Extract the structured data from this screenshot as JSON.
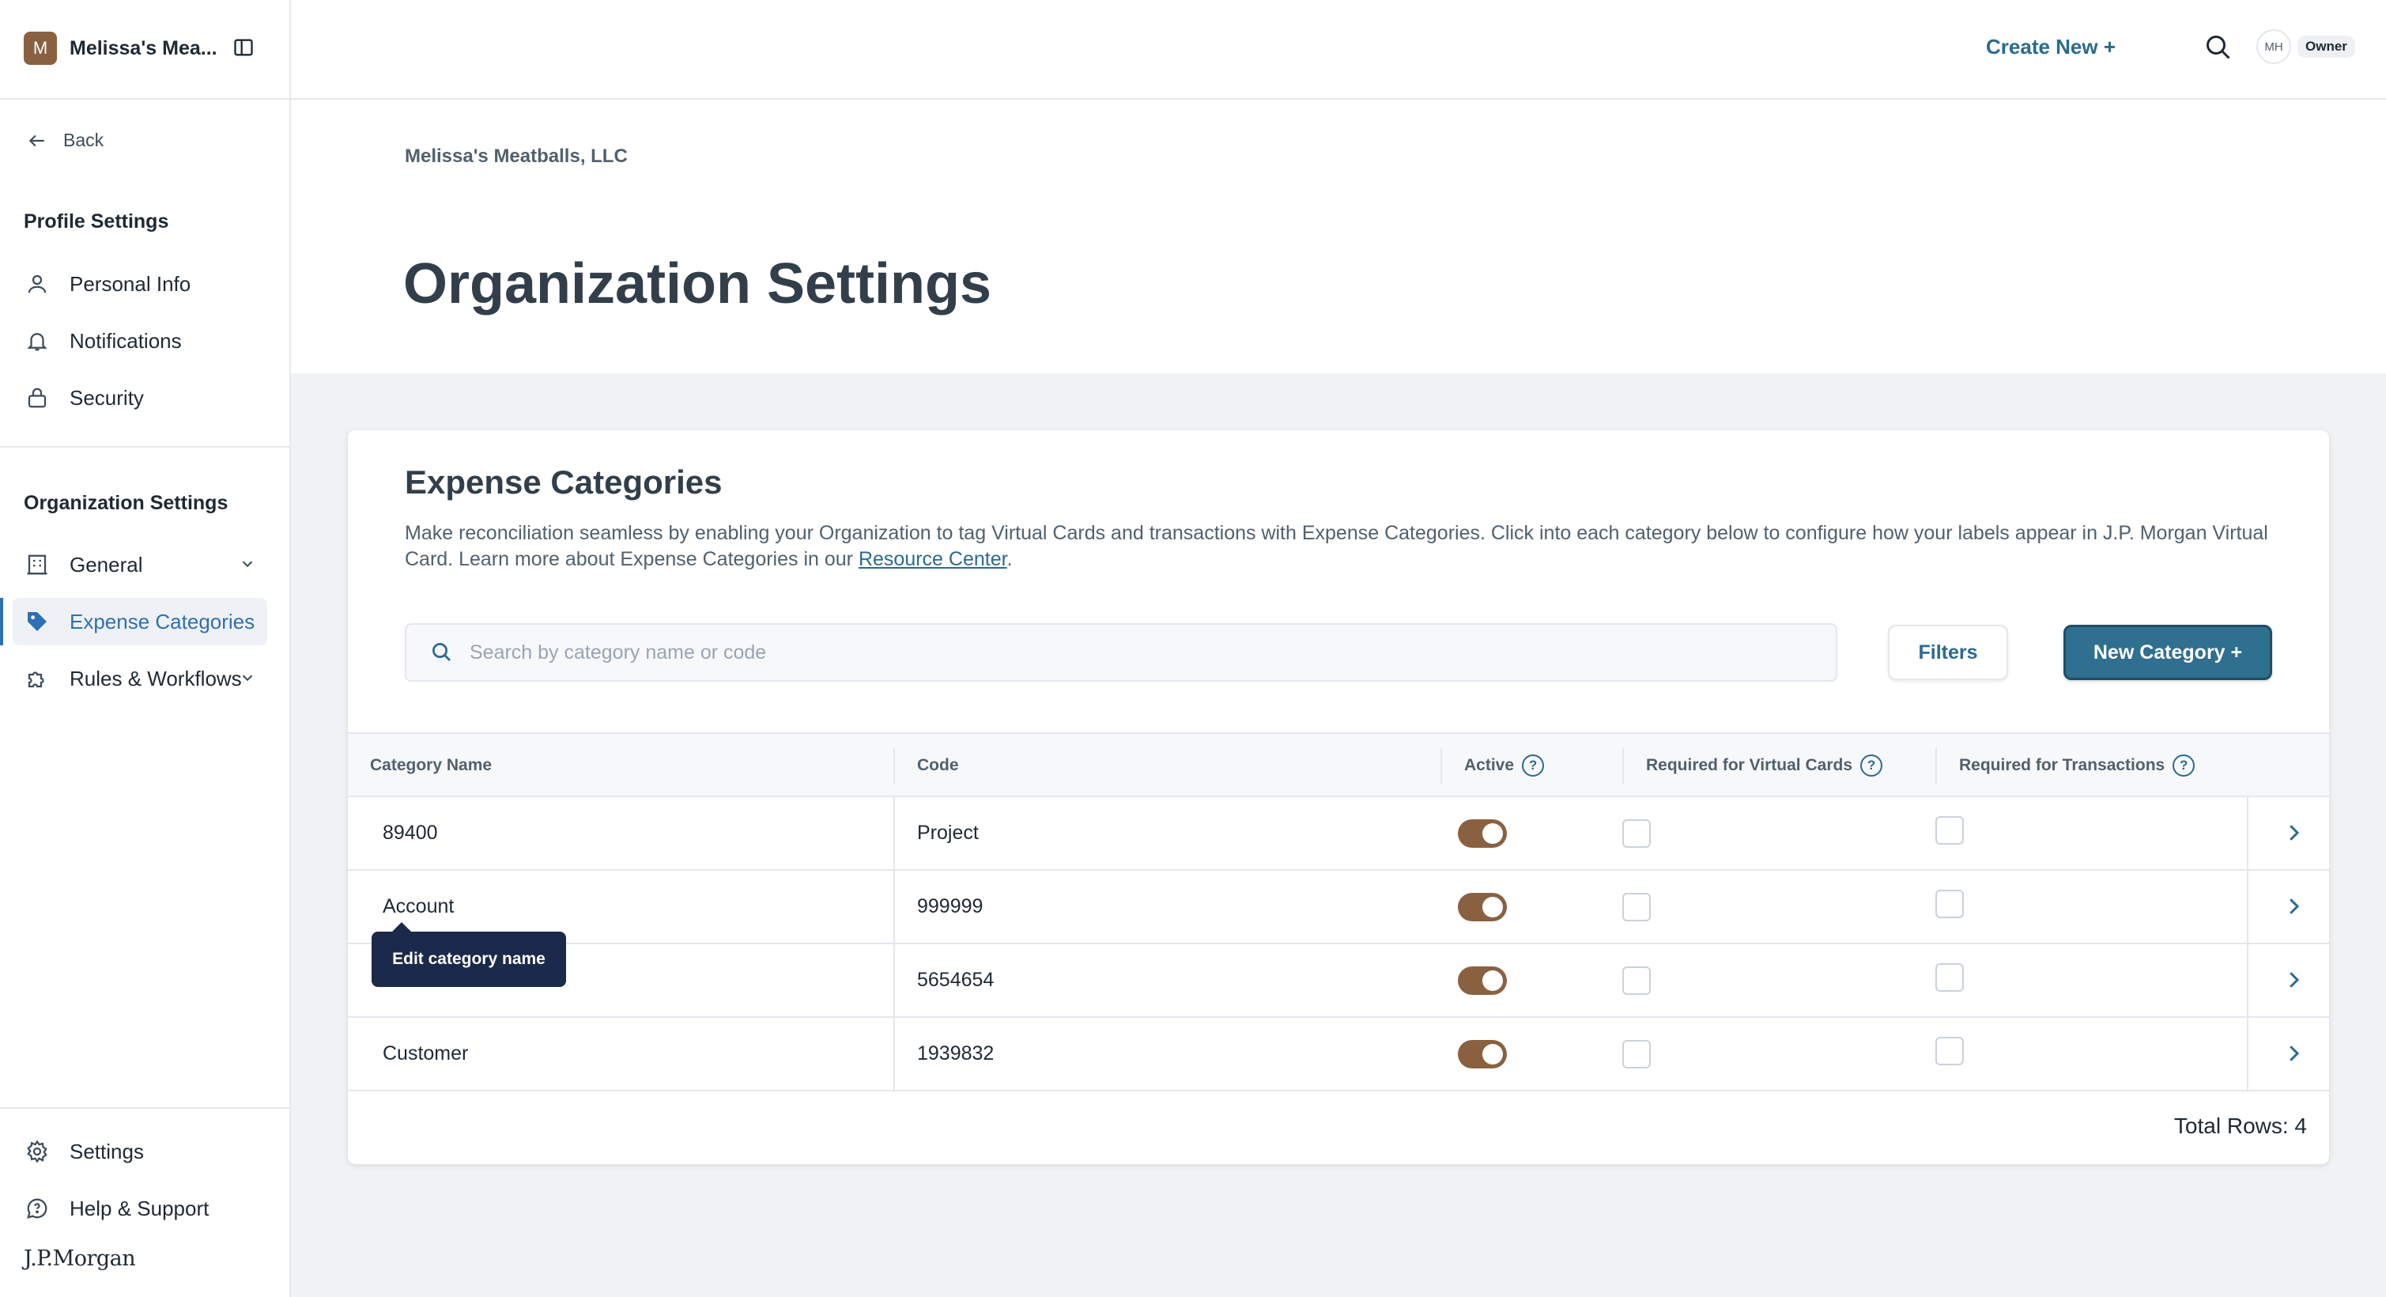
{
  "sidebar": {
    "org": {
      "initial": "M",
      "name": "Melissa's Mea..."
    },
    "back_label": "Back",
    "profile_heading": "Profile Settings",
    "profile_items": [
      {
        "label": "Personal Info",
        "icon": "user-icon"
      },
      {
        "label": "Notifications",
        "icon": "bell-icon"
      },
      {
        "label": "Security",
        "icon": "lock-icon"
      }
    ],
    "org_heading": "Organization Settings",
    "org_items": [
      {
        "label": "General",
        "icon": "building-icon",
        "expandable": true
      },
      {
        "label": "Expense Categories",
        "icon": "tag-icon",
        "active": true
      },
      {
        "label": "Rules & Workflows",
        "icon": "puzzle-icon",
        "expandable": true
      }
    ],
    "bottom_items": [
      {
        "label": "Settings",
        "icon": "gear-icon"
      },
      {
        "label": "Help & Support",
        "icon": "chat-icon"
      }
    ],
    "logo_text": "J.P.Morgan"
  },
  "topbar": {
    "create_new_label": "Create New +",
    "user_initials": "MH",
    "user_role": "Owner"
  },
  "header": {
    "breadcrumb": "Melissa's Meatballs, LLC",
    "title": "Organization Settings"
  },
  "card": {
    "title": "Expense Categories",
    "description_prefix": "Make reconciliation seamless by enabling your Organization to tag Virtual Cards and transactions with Expense Categories. Click into each category below to configure how your labels appear in J.P. Morgan Virtual Card. Learn more about Expense Categories in our ",
    "description_link": "Resource Center",
    "description_suffix": ".",
    "search_placeholder": "Search by category name or code",
    "search_value": "",
    "filters_label": "Filters",
    "new_category_label": "New Category +"
  },
  "table": {
    "columns": [
      "Category Name",
      "Code",
      "Active",
      "Required for Virtual Cards",
      "Required for Transactions"
    ],
    "rows": [
      {
        "name": "89400",
        "code": "Project",
        "active": true,
        "req_cards": false,
        "req_txn": false
      },
      {
        "name": "Account",
        "code": "999999",
        "active": true,
        "req_cards": false,
        "req_txn": false
      },
      {
        "name": "",
        "code": "5654654",
        "active": true,
        "req_cards": false,
        "req_txn": false
      },
      {
        "name": "Customer",
        "code": "1939832",
        "active": true,
        "req_cards": false,
        "req_txn": false
      }
    ],
    "total_rows_label": "Total Rows: 4"
  },
  "tooltip": {
    "text": "Edit category name"
  },
  "colors": {
    "accent": "#2b6a8f",
    "toggle_on": "#8a6140",
    "active_nav": "#2f6fb3",
    "tooltip_bg": "#1b2a4a"
  }
}
